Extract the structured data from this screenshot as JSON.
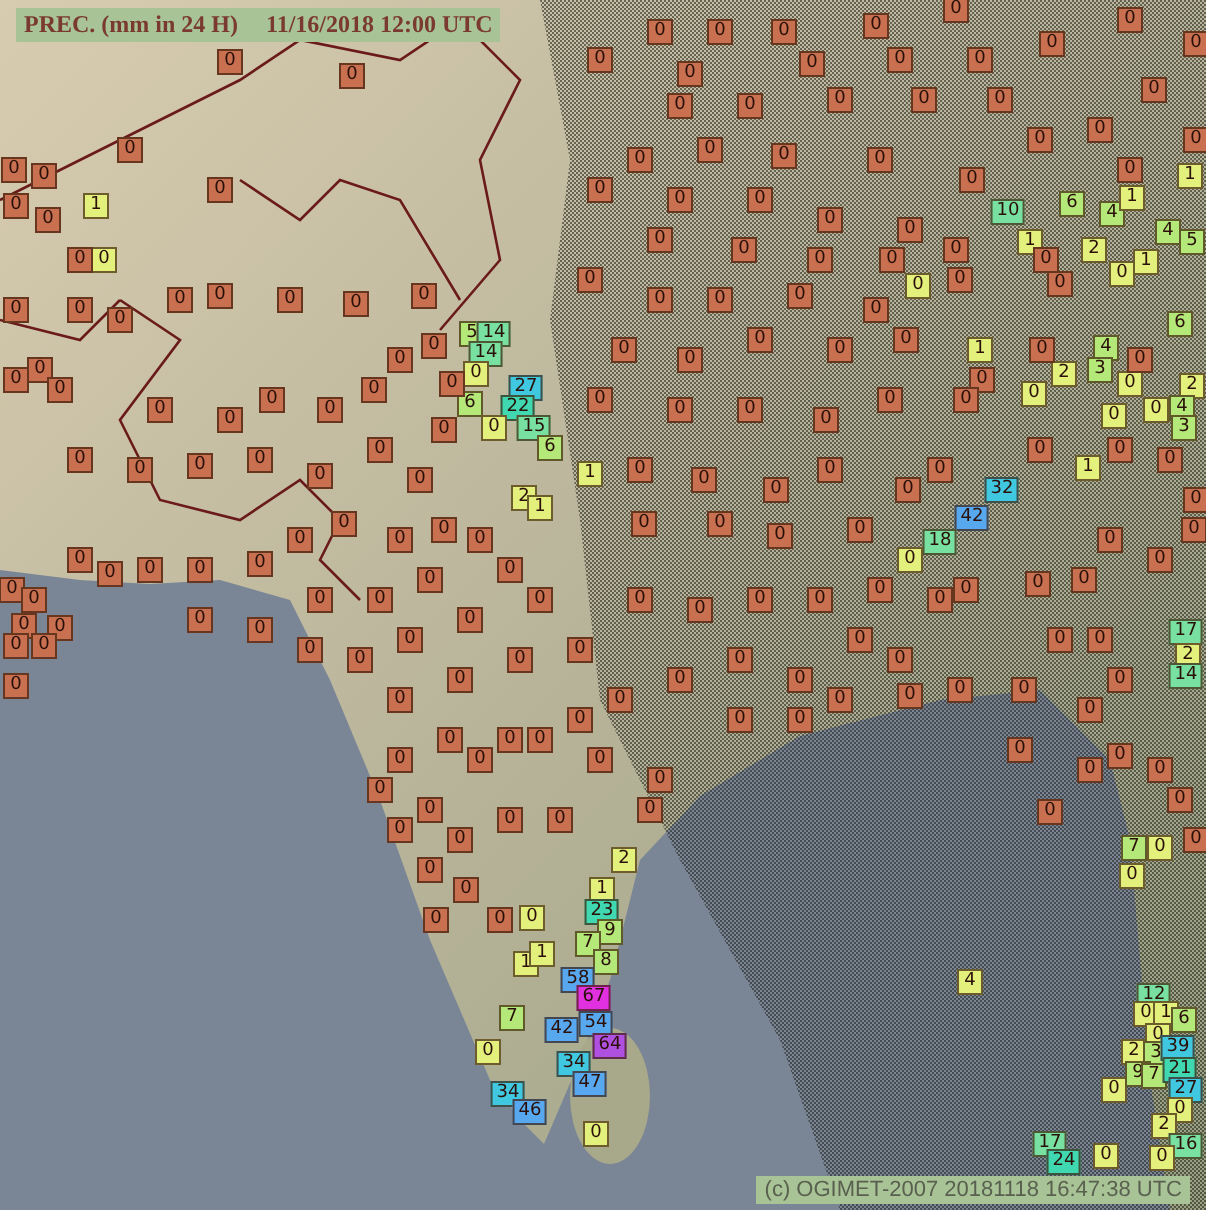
{
  "header": {
    "title": "PREC. (mm in 24 H)",
    "date": "11/16/2018 12:00 UTC"
  },
  "footer": "(c) OGIMET-2007 20181118 16:47:38 UTC",
  "stations": [
    {
      "value": "10",
      "color": "#78e0a0"
    },
    {
      "value": "6",
      "color": "#b4e878"
    },
    {
      "value": "4",
      "color": "#b4e878"
    },
    {
      "value": "1",
      "color": "#e4f07c"
    },
    {
      "value": "1",
      "color": "#e4f07c"
    },
    {
      "value": "4",
      "color": "#b4e878"
    },
    {
      "value": "1",
      "color": "#e4f07c"
    },
    {
      "value": "5",
      "color": "#b4e878"
    },
    {
      "value": "2",
      "color": "#e4f07c"
    },
    {
      "value": "1",
      "color": "#e4f07c"
    },
    {
      "value": "0",
      "color": "#e4f07c"
    },
    {
      "value": "0",
      "color": "#e4f07c"
    },
    {
      "value": "6",
      "color": "#b4e878"
    },
    {
      "value": "1",
      "color": "#e4f07c"
    },
    {
      "value": "4",
      "color": "#b4e878"
    },
    {
      "value": "2",
      "color": "#e4f07c"
    },
    {
      "value": "3",
      "color": "#b4e878"
    },
    {
      "value": "0",
      "color": "#e4f07c"
    },
    {
      "value": "0",
      "color": "#e4f07c"
    },
    {
      "value": "2",
      "color": "#e4f07c"
    },
    {
      "value": "0",
      "color": "#e4f07c"
    },
    {
      "value": "0",
      "color": "#e4f07c"
    },
    {
      "value": "4",
      "color": "#b4e878"
    },
    {
      "value": "3",
      "color": "#b4e878"
    },
    {
      "value": "1",
      "color": "#e4f07c"
    },
    {
      "value": "32",
      "color": "#40c8e0"
    },
    {
      "value": "42",
      "color": "#58a8f0"
    },
    {
      "value": "18",
      "color": "#78e0a0"
    },
    {
      "value": "0",
      "color": "#e4f07c"
    },
    {
      "value": "17",
      "color": "#78e0a0"
    },
    {
      "value": "2",
      "color": "#e4f07c"
    },
    {
      "value": "14",
      "color": "#78e0a0"
    },
    {
      "value": "5",
      "color": "#b4e878"
    },
    {
      "value": "14",
      "color": "#78e0a0"
    },
    {
      "value": "14",
      "color": "#78e0a0"
    },
    {
      "value": "0",
      "color": "#e4f07c"
    },
    {
      "value": "6",
      "color": "#b4e878"
    },
    {
      "value": "27",
      "color": "#40c8e0"
    },
    {
      "value": "22",
      "color": "#40d8b0"
    },
    {
      "value": "0",
      "color": "#e4f07c"
    },
    {
      "value": "15",
      "color": "#78e0a0"
    },
    {
      "value": "6",
      "color": "#b4e878"
    },
    {
      "value": "1",
      "color": "#e4f07c"
    },
    {
      "value": "2",
      "color": "#e4f07c"
    },
    {
      "value": "1",
      "color": "#e4f07c"
    },
    {
      "value": "2",
      "color": "#e4f07c"
    },
    {
      "value": "1",
      "color": "#e4f07c"
    },
    {
      "value": "23",
      "color": "#40d8b0"
    },
    {
      "value": "9",
      "color": "#b4e878"
    },
    {
      "value": "0",
      "color": "#e4f07c"
    },
    {
      "value": "1",
      "color": "#e4f07c"
    },
    {
      "value": "1",
      "color": "#e4f07c"
    },
    {
      "value": "7",
      "color": "#b4e878"
    },
    {
      "value": "8",
      "color": "#b4e878"
    },
    {
      "value": "58",
      "color": "#58a8f0"
    },
    {
      "value": "67",
      "color": "#e030e0"
    },
    {
      "value": "42",
      "color": "#58a8f0"
    },
    {
      "value": "54",
      "color": "#58a8f0"
    },
    {
      "value": "64",
      "color": "#b050e0"
    },
    {
      "value": "7",
      "color": "#b4e878"
    },
    {
      "value": "0",
      "color": "#e4f07c"
    },
    {
      "value": "34",
      "color": "#40c8e0"
    },
    {
      "value": "47",
      "color": "#58a8f0"
    },
    {
      "value": "34",
      "color": "#40c8e0"
    },
    {
      "value": "46",
      "color": "#58a8f0"
    },
    {
      "value": "0",
      "color": "#e4f07c"
    },
    {
      "value": "7",
      "color": "#b4e878"
    },
    {
      "value": "0",
      "color": "#e4f07c"
    },
    {
      "value": "0",
      "color": "#e4f07c"
    },
    {
      "value": "12",
      "color": "#78e0a0"
    },
    {
      "value": "0",
      "color": "#e4f07c"
    },
    {
      "value": "1",
      "color": "#e4f07c"
    },
    {
      "value": "6",
      "color": "#b4e878"
    },
    {
      "value": "0",
      "color": "#e4f07c"
    },
    {
      "value": "2",
      "color": "#e4f07c"
    },
    {
      "value": "3",
      "color": "#b4e878"
    },
    {
      "value": "39",
      "color": "#40c8e0"
    },
    {
      "value": "0",
      "color": "#e4f07c"
    },
    {
      "value": "9",
      "color": "#b4e878"
    },
    {
      "value": "7",
      "color": "#b4e878"
    },
    {
      "value": "21",
      "color": "#40d8b0"
    },
    {
      "value": "27",
      "color": "#40c8e0"
    },
    {
      "value": "0",
      "color": "#e4f07c"
    },
    {
      "value": "2",
      "color": "#e4f07c"
    },
    {
      "value": "16",
      "color": "#78e0a0"
    },
    {
      "value": "17",
      "color": "#78e0a0"
    },
    {
      "value": "24",
      "color": "#40d8b0"
    },
    {
      "value": "0",
      "color": "#e4f07c"
    },
    {
      "value": "0",
      "color": "#e4f07c"
    },
    {
      "value": "4",
      "color": "#e4f07c"
    },
    {
      "value": "1",
      "color": "#e4f07c"
    },
    {
      "value": "0",
      "color": "#e4f07c"
    },
    {
      "value": "0",
      "color": "#c87050"
    },
    {
      "value": "0",
      "color": "#c87050"
    },
    {
      "value": "0",
      "color": "#c87050"
    },
    {
      "value": "0",
      "color": "#c87050"
    },
    {
      "value": "0",
      "color": "#c87050"
    },
    {
      "value": "0",
      "color": "#c87050"
    },
    {
      "value": "0",
      "color": "#c87050"
    },
    {
      "value": "0",
      "color": "#c87050"
    },
    {
      "value": "0",
      "color": "#c87050"
    },
    {
      "value": "0",
      "color": "#c87050"
    },
    {
      "value": "0",
      "color": "#c87050"
    },
    {
      "value": "0",
      "color": "#c87050"
    },
    {
      "value": "0",
      "color": "#c87050"
    },
    {
      "value": "0",
      "color": "#c87050"
    },
    {
      "value": "0",
      "color": "#c87050"
    },
    {
      "value": "0",
      "color": "#c87050"
    },
    {
      "value": "0",
      "color": "#c87050"
    },
    {
      "value": "0",
      "color": "#c87050"
    },
    {
      "value": "0",
      "color": "#c87050"
    },
    {
      "value": "0",
      "color": "#c87050"
    },
    {
      "value": "0",
      "color": "#c87050"
    },
    {
      "value": "0",
      "color": "#c87050"
    },
    {
      "value": "0",
      "color": "#c87050"
    },
    {
      "value": "0",
      "color": "#c87050"
    },
    {
      "value": "0",
      "color": "#c87050"
    },
    {
      "value": "0",
      "color": "#c87050"
    },
    {
      "value": "0",
      "color": "#c87050"
    },
    {
      "value": "0",
      "color": "#c87050"
    },
    {
      "value": "0",
      "color": "#c87050"
    },
    {
      "value": "0",
      "color": "#c87050"
    },
    {
      "value": "0",
      "color": "#c87050"
    },
    {
      "value": "0",
      "color": "#c87050"
    },
    {
      "value": "0",
      "color": "#c87050"
    },
    {
      "value": "0",
      "color": "#c87050"
    },
    {
      "value": "0",
      "color": "#c87050"
    },
    {
      "value": "0",
      "color": "#c87050"
    },
    {
      "value": "0",
      "color": "#c87050"
    },
    {
      "value": "0",
      "color": "#c87050"
    },
    {
      "value": "0",
      "color": "#c87050"
    },
    {
      "value": "0",
      "color": "#c87050"
    },
    {
      "value": "0",
      "color": "#c87050"
    },
    {
      "value": "0",
      "color": "#c87050"
    },
    {
      "value": "0",
      "color": "#c87050"
    },
    {
      "value": "0",
      "color": "#c87050"
    },
    {
      "value": "0",
      "color": "#c87050"
    },
    {
      "value": "0",
      "color": "#c87050"
    },
    {
      "value": "0",
      "color": "#c87050"
    },
    {
      "value": "0",
      "color": "#c87050"
    },
    {
      "value": "0",
      "color": "#c87050"
    },
    {
      "value": "0",
      "color": "#c87050"
    },
    {
      "value": "0",
      "color": "#c87050"
    },
    {
      "value": "0",
      "color": "#c87050"
    },
    {
      "value": "0",
      "color": "#c87050"
    },
    {
      "value": "0",
      "color": "#c87050"
    },
    {
      "value": "0",
      "color": "#c87050"
    },
    {
      "value": "0",
      "color": "#c87050"
    },
    {
      "value": "0",
      "color": "#c87050"
    },
    {
      "value": "0",
      "color": "#c87050"
    },
    {
      "value": "0",
      "color": "#c87050"
    },
    {
      "value": "0",
      "color": "#c87050"
    },
    {
      "value": "0",
      "color": "#c87050"
    },
    {
      "value": "0",
      "color": "#c87050"
    },
    {
      "value": "0",
      "color": "#c87050"
    },
    {
      "value": "0",
      "color": "#c87050"
    },
    {
      "value": "0",
      "color": "#c87050"
    },
    {
      "value": "0",
      "color": "#c87050"
    },
    {
      "value": "0",
      "color": "#c87050"
    },
    {
      "value": "0",
      "color": "#c87050"
    },
    {
      "value": "0",
      "color": "#c87050"
    },
    {
      "value": "0",
      "color": "#c87050"
    },
    {
      "value": "0",
      "color": "#c87050"
    },
    {
      "value": "0",
      "color": "#c87050"
    },
    {
      "value": "0",
      "color": "#c87050"
    },
    {
      "value": "0",
      "color": "#c87050"
    },
    {
      "value": "0",
      "color": "#c87050"
    },
    {
      "value": "0",
      "color": "#c87050"
    },
    {
      "value": "0",
      "color": "#c87050"
    },
    {
      "value": "0",
      "color": "#c87050"
    },
    {
      "value": "0",
      "color": "#c87050"
    },
    {
      "value": "0",
      "color": "#c87050"
    },
    {
      "value": "0",
      "color": "#c87050"
    },
    {
      "value": "0",
      "color": "#c87050"
    },
    {
      "value": "0",
      "color": "#c87050"
    },
    {
      "value": "0",
      "color": "#c87050"
    },
    {
      "value": "0",
      "color": "#c87050"
    },
    {
      "value": "0",
      "color": "#c87050"
    },
    {
      "value": "0",
      "color": "#c87050"
    },
    {
      "value": "0",
      "color": "#c87050"
    },
    {
      "value": "0",
      "color": "#c87050"
    },
    {
      "value": "0",
      "color": "#c87050"
    },
    {
      "value": "0",
      "color": "#c87050"
    },
    {
      "value": "0",
      "color": "#c87050"
    },
    {
      "value": "0",
      "color": "#c87050"
    },
    {
      "value": "0",
      "color": "#c87050"
    },
    {
      "value": "0",
      "color": "#c87050"
    },
    {
      "value": "0",
      "color": "#c87050"
    },
    {
      "value": "0",
      "color": "#c87050"
    },
    {
      "value": "0",
      "color": "#c87050"
    },
    {
      "value": "0",
      "color": "#c87050"
    },
    {
      "value": "0",
      "color": "#c87050"
    },
    {
      "value": "0",
      "color": "#c87050"
    },
    {
      "value": "0",
      "color": "#c87050"
    },
    {
      "value": "0",
      "color": "#c87050"
    },
    {
      "value": "0",
      "color": "#c87050"
    },
    {
      "value": "0",
      "color": "#c87050"
    },
    {
      "value": "0",
      "color": "#c87050"
    },
    {
      "value": "0",
      "color": "#c87050"
    },
    {
      "value": "0",
      "color": "#c87050"
    },
    {
      "value": "0",
      "color": "#c87050"
    },
    {
      "value": "0",
      "color": "#c87050"
    },
    {
      "value": "0",
      "color": "#c87050"
    },
    {
      "value": "0",
      "color": "#c87050"
    },
    {
      "value": "0",
      "color": "#c87050"
    },
    {
      "value": "0",
      "color": "#c87050"
    },
    {
      "value": "0",
      "color": "#c87050"
    },
    {
      "value": "0",
      "color": "#c87050"
    },
    {
      "value": "0",
      "color": "#c87050"
    },
    {
      "value": "0",
      "color": "#c87050"
    },
    {
      "value": "0",
      "color": "#c87050"
    },
    {
      "value": "0",
      "color": "#c87050"
    },
    {
      "value": "0",
      "color": "#c87050"
    },
    {
      "value": "0",
      "color": "#c87050"
    },
    {
      "value": "0",
      "color": "#c87050"
    },
    {
      "value": "0",
      "color": "#c87050"
    },
    {
      "value": "0",
      "color": "#c87050"
    },
    {
      "value": "0",
      "color": "#c87050"
    },
    {
      "value": "0",
      "color": "#c87050"
    },
    {
      "value": "0",
      "color": "#c87050"
    },
    {
      "value": "0",
      "color": "#c87050"
    },
    {
      "value": "0",
      "color": "#c87050"
    },
    {
      "value": "0",
      "color": "#c87050"
    },
    {
      "value": "0",
      "color": "#c87050"
    },
    {
      "value": "0",
      "color": "#c87050"
    },
    {
      "value": "0",
      "color": "#c87050"
    },
    {
      "value": "0",
      "color": "#c87050"
    },
    {
      "value": "0",
      "color": "#c87050"
    },
    {
      "value": "0",
      "color": "#c87050"
    },
    {
      "value": "0",
      "color": "#c87050"
    },
    {
      "value": "0",
      "color": "#c87050"
    },
    {
      "value": "0",
      "color": "#c87050"
    },
    {
      "value": "0",
      "color": "#c87050"
    },
    {
      "value": "0",
      "color": "#c87050"
    },
    {
      "value": "0",
      "color": "#c87050"
    },
    {
      "value": "0",
      "color": "#c87050"
    },
    {
      "value": "0",
      "color": "#c87050"
    },
    {
      "value": "0",
      "color": "#c87050"
    },
    {
      "value": "0",
      "color": "#c87050"
    },
    {
      "value": "0",
      "color": "#c87050"
    },
    {
      "value": "0",
      "color": "#c87050"
    },
    {
      "value": "0",
      "color": "#c87050"
    },
    {
      "value": "0",
      "color": "#c87050"
    },
    {
      "value": "0",
      "color": "#c87050"
    },
    {
      "value": "0",
      "color": "#c87050"
    },
    {
      "value": "0",
      "color": "#c87050"
    },
    {
      "value": "0",
      "color": "#c87050"
    },
    {
      "value": "0",
      "color": "#c87050"
    },
    {
      "value": "0",
      "color": "#c87050"
    },
    {
      "value": "0",
      "color": "#c87050"
    },
    {
      "value": "0",
      "color": "#c87050"
    },
    {
      "value": "0",
      "color": "#c87050"
    },
    {
      "value": "0",
      "color": "#c87050"
    },
    {
      "value": "0",
      "color": "#c87050"
    },
    {
      "value": "0",
      "color": "#c87050"
    },
    {
      "value": "0",
      "color": "#c87050"
    },
    {
      "value": "0",
      "color": "#c87050"
    },
    {
      "value": "0",
      "color": "#c87050"
    },
    {
      "value": "0",
      "color": "#c87050"
    },
    {
      "value": "0",
      "color": "#c87050"
    },
    {
      "value": "0",
      "color": "#c87050"
    },
    {
      "value": "0",
      "color": "#c87050"
    },
    {
      "value": "0",
      "color": "#c87050"
    },
    {
      "value": "0",
      "color": "#c87050"
    },
    {
      "value": "0",
      "color": "#c87050"
    },
    {
      "value": "0",
      "color": "#c87050"
    },
    {
      "value": "0",
      "color": "#c87050"
    },
    {
      "value": "0",
      "color": "#c87050"
    },
    {
      "value": "0",
      "color": "#c87050"
    },
    {
      "value": "0",
      "color": "#c87050"
    },
    {
      "value": "0",
      "color": "#c87050"
    },
    {
      "value": "0",
      "color": "#c87050"
    },
    {
      "value": "0",
      "color": "#c87050"
    },
    {
      "value": "0",
      "color": "#c87050"
    },
    {
      "value": "0",
      "color": "#c87050"
    },
    {
      "value": "0",
      "color": "#c87050"
    },
    {
      "value": "0",
      "color": "#c87050"
    },
    {
      "value": "0",
      "color": "#c87050"
    },
    {
      "value": "0",
      "color": "#c87050"
    },
    {
      "value": "0",
      "color": "#c87050"
    },
    {
      "value": "0",
      "color": "#c87050"
    },
    {
      "value": "0",
      "color": "#c87050"
    },
    {
      "value": "0",
      "color": "#c87050"
    },
    {
      "value": "0",
      "color": "#c87050"
    },
    {
      "value": "0",
      "color": "#c87050"
    },
    {
      "value": "0",
      "color": "#c87050"
    },
    {
      "value": "0",
      "color": "#c87050"
    },
    {
      "value": "0",
      "color": "#c87050"
    }
  ]
}
